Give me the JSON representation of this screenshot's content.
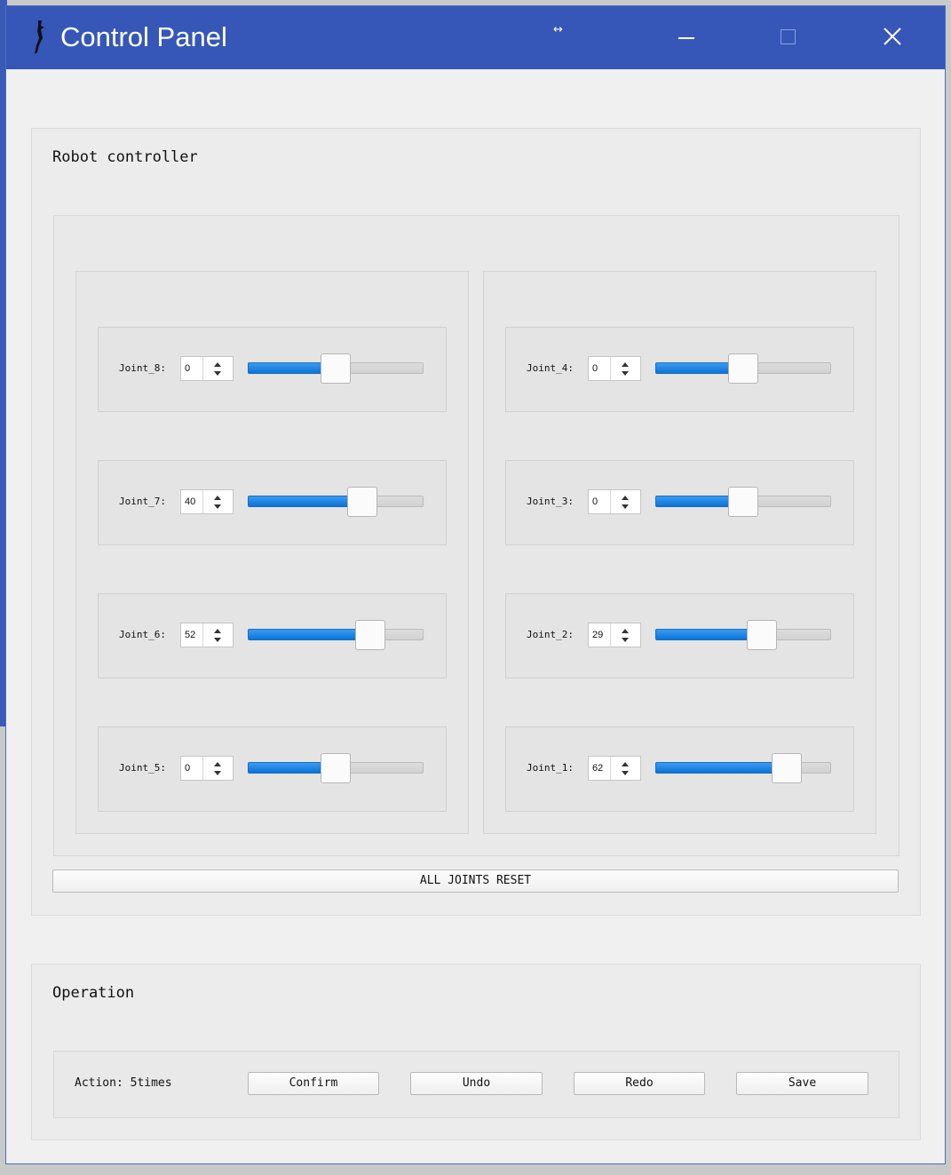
{
  "window": {
    "title": "Control Panel"
  },
  "robot_controller": {
    "title": "Robot controller",
    "reset_label": "ALL JOINTS RESET",
    "left_joints": [
      {
        "label": "Joint_8:",
        "value": "0",
        "fraction": 0.5
      },
      {
        "label": "Joint_7:",
        "value": "40",
        "fraction": 0.68
      },
      {
        "label": "Joint_6:",
        "value": "52",
        "fraction": 0.74
      },
      {
        "label": "Joint_5:",
        "value": "0",
        "fraction": 0.5
      }
    ],
    "right_joints": [
      {
        "label": "Joint_4:",
        "value": "0",
        "fraction": 0.5
      },
      {
        "label": "Joint_3:",
        "value": "0",
        "fraction": 0.5
      },
      {
        "label": "Joint_2:",
        "value": "29",
        "fraction": 0.63
      },
      {
        "label": "Joint_1:",
        "value": "62",
        "fraction": 0.8
      }
    ]
  },
  "operation": {
    "title": "Operation",
    "action_text": "Action: 5times",
    "confirm_label": "Confirm",
    "undo_label": "Undo",
    "redo_label": "Redo",
    "save_label": "Save"
  },
  "colors": {
    "titlebar": "#3657b8",
    "slider_fill": "#1a82e2"
  }
}
